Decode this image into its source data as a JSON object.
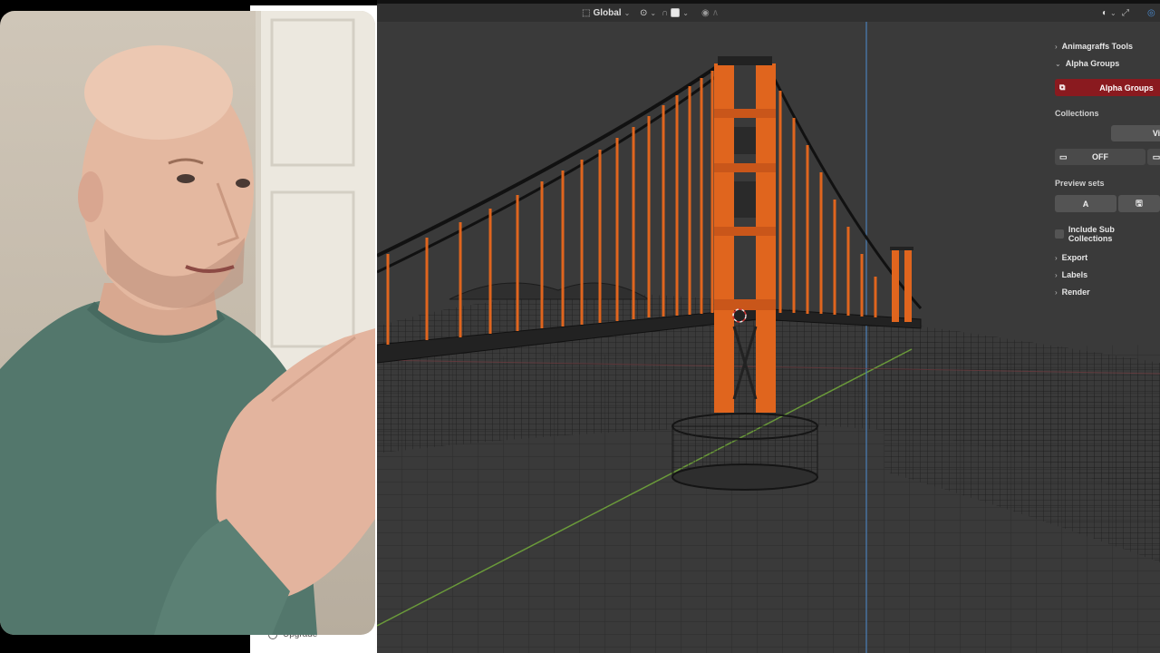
{
  "webcam": {
    "upgrade_label": "Upgrade"
  },
  "viewport_header": {
    "transform_orientation": "Global"
  },
  "sidebar": {
    "animagraffs_tools": "Animagraffs Tools",
    "alpha_groups": "Alpha Groups",
    "alpha_groups_button": "Alpha Groups",
    "collections_label": "Collections",
    "vi_button": "Vi",
    "off_button": "OFF",
    "preview_sets_label": "Preview sets",
    "a_button": "A",
    "include_sub_collections": "Include Sub Collections",
    "export": "Export",
    "labels": "Labels",
    "render": "Render"
  },
  "colors": {
    "viewport_bg": "#3a3a3a",
    "bridge_orange": "#e0651e",
    "red_button": "#8a1a1f",
    "y_axis": "#6a9a3a",
    "z_axis": "#4a7fb8"
  },
  "icons": [
    "chevron-right-icon",
    "chevron-down-icon",
    "collection-icon",
    "monitor-icon",
    "save-icon",
    "view-icon",
    "snap-icon",
    "proportional-icon",
    "gizmo-icon"
  ]
}
